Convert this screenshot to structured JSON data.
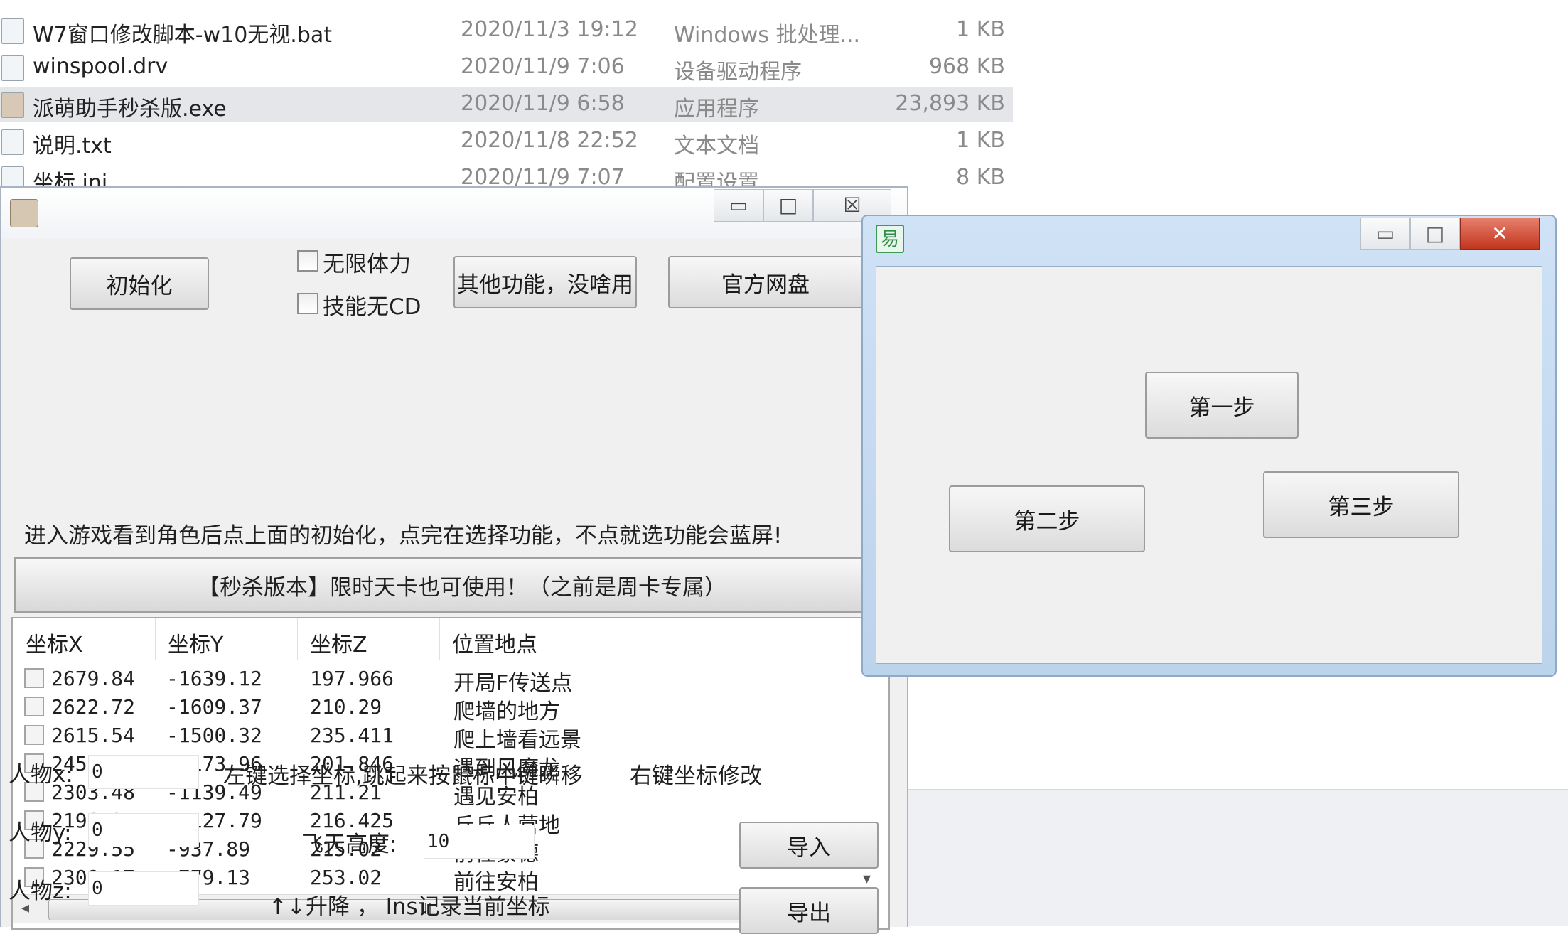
{
  "explorer": {
    "files": [
      {
        "name": "W7窗口修改脚本-w10无视.bat",
        "date": "2020/11/3 19:12",
        "type": "Windows 批处理...",
        "size": "1 KB",
        "icon": "bat-file-icon"
      },
      {
        "name": "winspool.drv",
        "date": "2020/11/9 7:06",
        "type": "设备驱动程序",
        "size": "968 KB",
        "icon": "driver-file-icon"
      },
      {
        "name": "派萌助手秒杀版.exe",
        "date": "2020/11/9 6:58",
        "type": "应用程序",
        "size": "23,893 KB",
        "icon": "exe-file-icon"
      },
      {
        "name": "说明.txt",
        "date": "2020/11/8 22:52",
        "type": "文本文档",
        "size": "1 KB",
        "icon": "txt-file-icon"
      },
      {
        "name": "坐标.ini",
        "date": "2020/11/9 7:07",
        "type": "配置设置",
        "size": "8 KB",
        "icon": "ini-file-icon"
      }
    ]
  },
  "main_window": {
    "caption": {
      "minimize": "▭",
      "maximize": "□",
      "close": "☒"
    },
    "init_button": "初始化",
    "unlimited_stamina": {
      "label": "无限体力",
      "checked": false
    },
    "no_skill_cd": {
      "label": "技能无CD",
      "checked": false
    },
    "other_button": "其他功能，没啥用",
    "netdisk_button": "官方网盘",
    "notice": "进入游戏看到角色后点上面的初始化，点完在选择功能，不点就选功能会蓝屏!",
    "banner": "【秒杀版本】限时天卡也可使用！（之前是周卡专属）",
    "table": {
      "headers": [
        "坐标X",
        "坐标Y",
        "坐标Z",
        "位置地点"
      ],
      "rows": [
        [
          "2679.84",
          "-1639.12",
          "197.966",
          "开局F传送点"
        ],
        [
          "2622.72",
          "-1609.37",
          "210.29",
          "爬墙的地方"
        ],
        [
          "2615.54",
          "-1500.32",
          "235.411",
          "爬上墙看远景"
        ],
        [
          "2451.58",
          "-1173.96",
          "201.846",
          "遇到风魔龙"
        ],
        [
          "2303.48",
          "-1139.49",
          "211.21",
          "遇见安柏"
        ],
        [
          "2196.31",
          "-1127.79",
          "216.425",
          "丘丘人营地"
        ],
        [
          "2229.55",
          "-937.89",
          "215.02",
          "前往蒙德"
        ],
        [
          "2308.17",
          "-779.13",
          "253.02",
          "前往安柏"
        ]
      ],
      "scroll_grip": "III",
      "left_arrow": "◂",
      "right_arrow": "▸",
      "down_arrow": "▾"
    },
    "char_x": {
      "label": "人物x:",
      "value": "0"
    },
    "char_y": {
      "label": "人物y:",
      "value": "0"
    },
    "char_z": {
      "label": "人物z:",
      "value": "0"
    },
    "hint_left": "左键选择坐标,跳起来按鼠标中键瞬移",
    "hint_right": "右键坐标修改",
    "fly_height": {
      "label": "飞天高度:",
      "value": "10"
    },
    "import_button": "导入",
    "export_button": "导出",
    "hotkeys": "↑↓升降 ， Ins记录当前坐标"
  },
  "dialog": {
    "icon_glyph": "易",
    "caption": {
      "minimize": "▭",
      "maximize": "□",
      "close": "✕"
    },
    "step1": "第一步",
    "step2": "第二步",
    "step3": "第三步"
  }
}
